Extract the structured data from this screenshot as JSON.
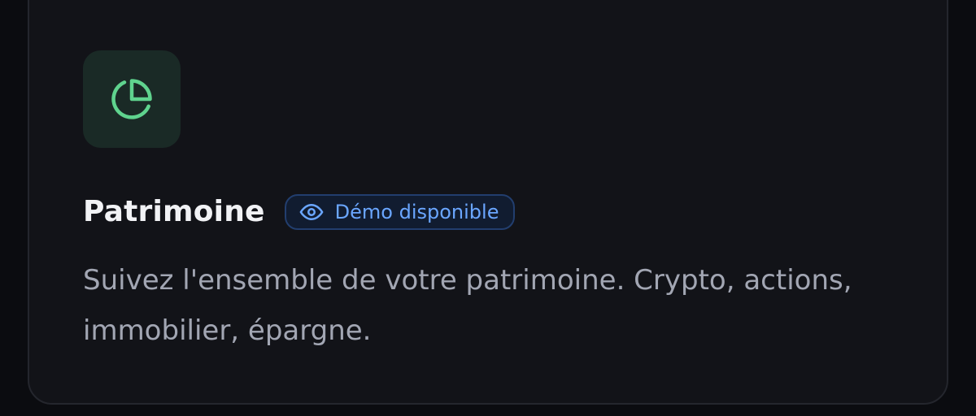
{
  "card": {
    "icon": "pie-chart-icon",
    "title": "Patrimoine",
    "badge": {
      "icon": "eye-icon",
      "label": "Démo disponible"
    },
    "description": "Suivez l'ensemble de votre patrimoine. Crypto, actions, immobilier, épargne."
  },
  "colors": {
    "accent_green": "#5fd38e",
    "badge_blue": "#6aa6ff"
  }
}
